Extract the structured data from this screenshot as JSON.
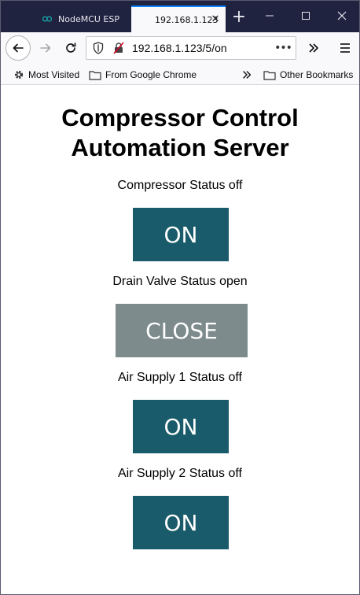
{
  "browser": {
    "tabs": [
      {
        "title": "NodeMCU ESP",
        "active": false
      },
      {
        "title": "192.168.1.123",
        "active": true
      }
    ],
    "new_tab_label": "+",
    "url": "192.168.1.123/5/on",
    "bookmarks": [
      {
        "label": "Most Visited",
        "icon": "gear-icon"
      },
      {
        "label": "From Google Chrome",
        "icon": "folder-icon"
      },
      {
        "label": "Other Bookmarks",
        "icon": "folder-icon"
      }
    ]
  },
  "page": {
    "title_line1": "Compressor Control",
    "title_line2": "Automation Server",
    "controls": [
      {
        "status_text": "Compressor Status off",
        "button_label": "ON"
      },
      {
        "status_text": "Drain Valve Status open",
        "button_label": "CLOSE"
      },
      {
        "status_text": "Air Supply 1 Status off",
        "button_label": "ON"
      },
      {
        "status_text": "Air Supply 2 Status off",
        "button_label": "ON"
      }
    ]
  },
  "colors": {
    "on_button": "#195b6a",
    "close_button": "#7d8b8d",
    "tabstrip": "#202340",
    "accent": "#0a84ff"
  }
}
